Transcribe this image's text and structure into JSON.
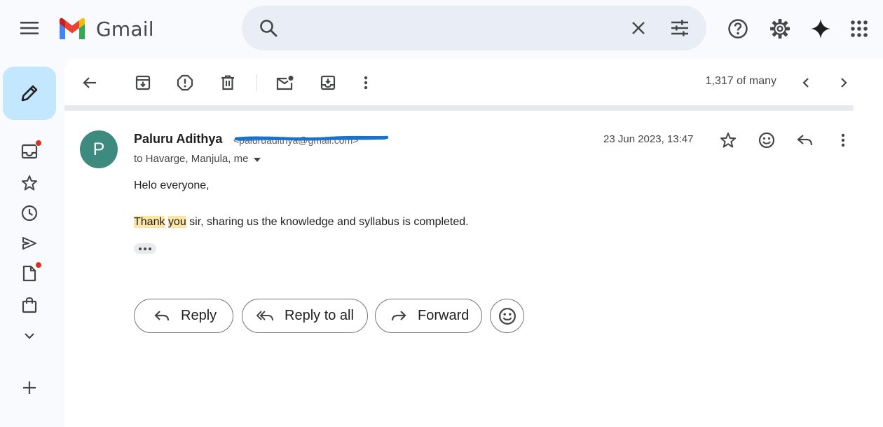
{
  "app": {
    "name": "Gmail"
  },
  "search": {
    "placeholder": "",
    "value": ""
  },
  "icons": {
    "menu": "menu-icon",
    "search": "search-icon",
    "clear": "close-icon",
    "filter": "tune-icon",
    "help": "help-icon",
    "settings": "gear-icon",
    "gemini": "sparkle-icon",
    "apps": "apps-grid-icon",
    "compose": "pencil-icon"
  },
  "rail": [
    {
      "name": "inbox",
      "icon": "inbox-icon",
      "badge": true
    },
    {
      "name": "starred",
      "icon": "star-icon",
      "badge": false
    },
    {
      "name": "snoozed",
      "icon": "clock-icon",
      "badge": false
    },
    {
      "name": "sent",
      "icon": "send-icon",
      "badge": false
    },
    {
      "name": "drafts",
      "icon": "file-icon",
      "badge": true
    },
    {
      "name": "purchases",
      "icon": "shopping-bag-icon",
      "badge": false
    },
    {
      "name": "more",
      "icon": "chevron-down-icon",
      "badge": false
    },
    {
      "name": "new-label",
      "icon": "plus-icon",
      "badge": false
    }
  ],
  "toolbar": {
    "count_label": "1,317 of many",
    "actions": [
      "back",
      "archive",
      "report-spam",
      "delete",
      "mark-unread",
      "move-to",
      "more"
    ]
  },
  "message": {
    "avatar_letter": "P",
    "sender_name": "Paluru Adithya",
    "sender_email": "<paluruadithya@gmail.com>",
    "recipients": "to Havarge, Manjula, me",
    "date": "23 Jun 2023, 13:47",
    "greeting": "Helo everyone,",
    "body_hl1": "Thank",
    "body_hl2": "you",
    "body_rest": " sir, sharing us the knowledge and syllabus is completed."
  },
  "actions": {
    "reply": "Reply",
    "reply_all": "Reply to all",
    "forward": "Forward"
  },
  "colors": {
    "background": "#f8fafd",
    "search_bg": "#e9eef6",
    "compose_bg": "#c2e7ff",
    "avatar_bg": "#3d8b7f",
    "highlight": "#fde5a6",
    "badge": "#d93025",
    "scribble": "#1a73c8"
  }
}
